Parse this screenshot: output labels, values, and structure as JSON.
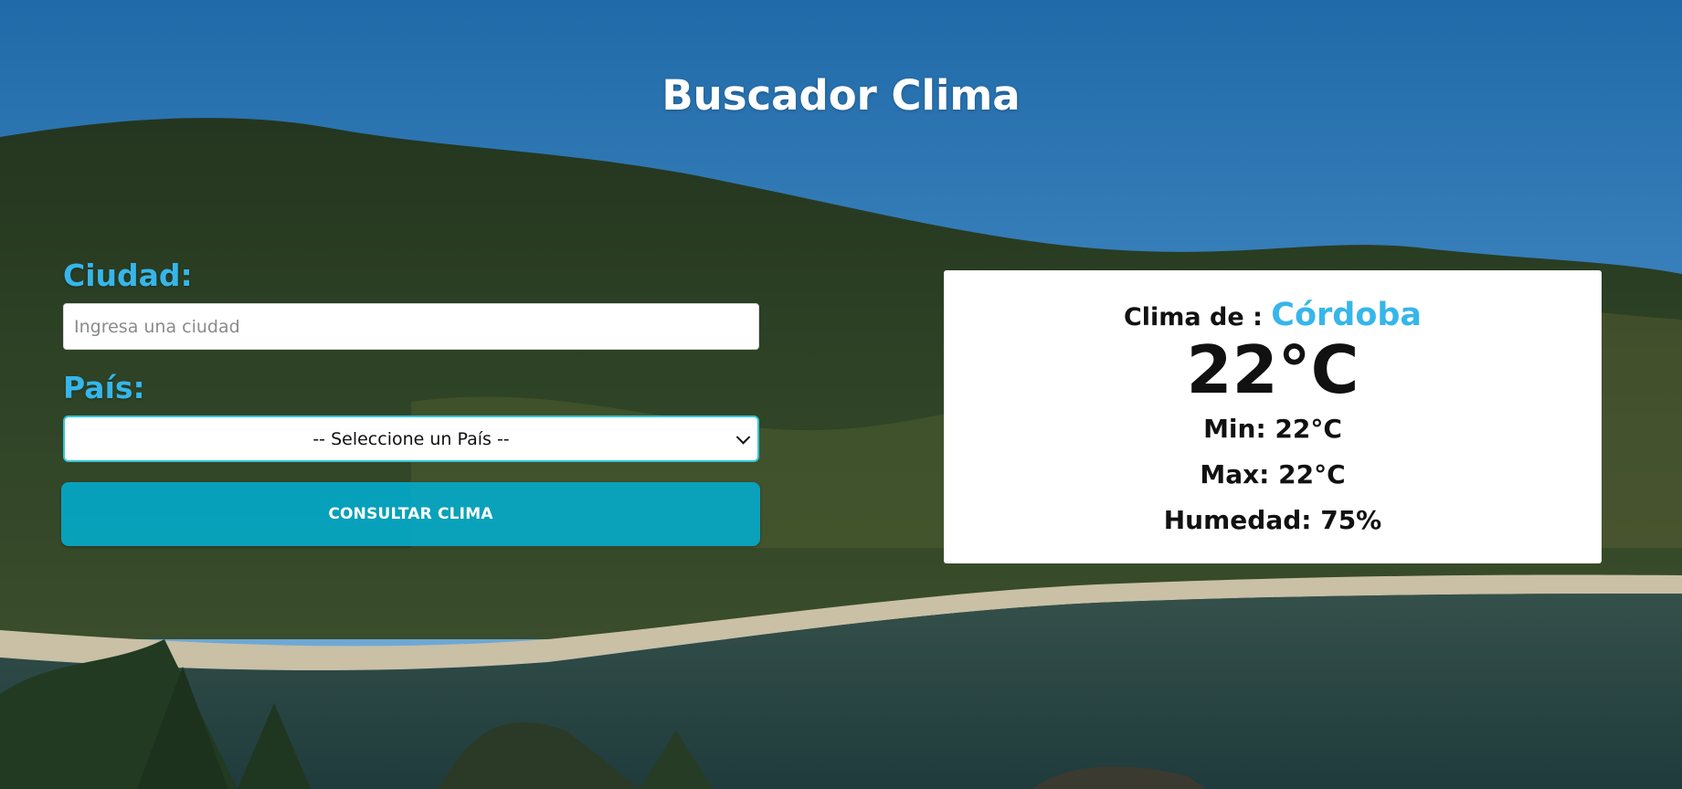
{
  "page": {
    "title": "Buscador Clima"
  },
  "form": {
    "city_label": "Ciudad:",
    "city_placeholder": "Ingresa una ciudad",
    "city_value": "",
    "country_label": "País:",
    "country_selected": "-- Seleccione un País --",
    "submit_label": "CONSULTAR CLIMA"
  },
  "result": {
    "heading_prefix": "Clima de :",
    "city": "Córdoba",
    "temperature": "22°C",
    "min": "Min: 22°C",
    "max": "Max: 22°C",
    "humidity": "Humedad: 75%"
  },
  "colors": {
    "accent": "#36b6ea",
    "button": "#00b0d3",
    "card_bg": "#ffffff",
    "title": "#ffffff"
  }
}
